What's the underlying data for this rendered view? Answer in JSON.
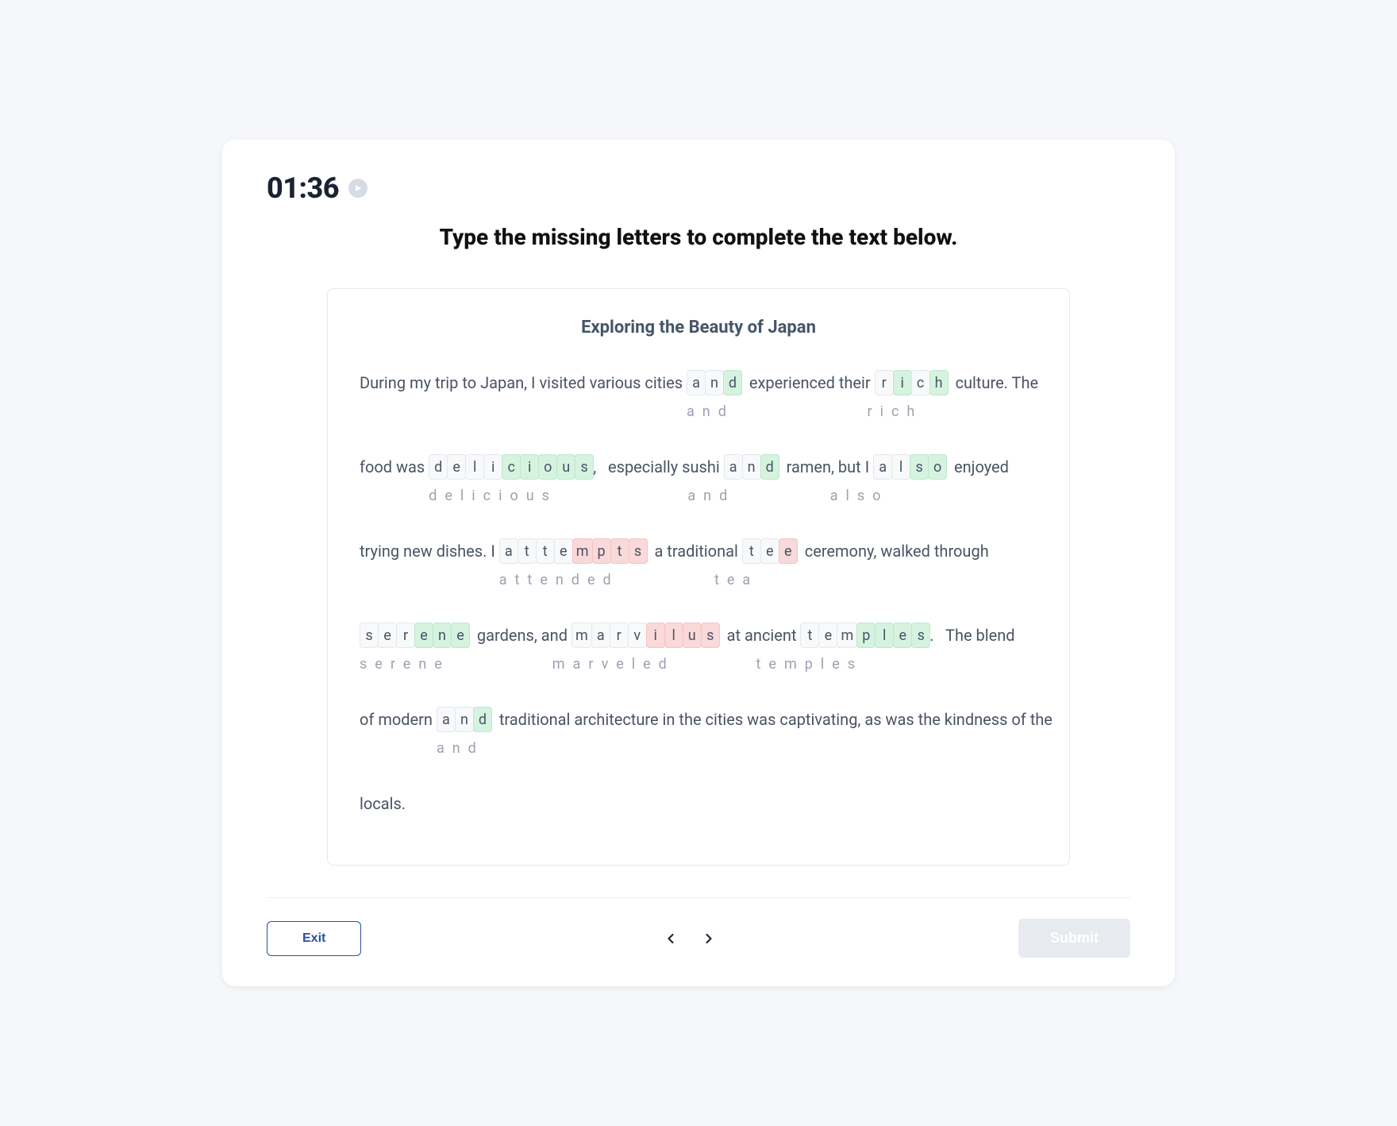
{
  "timer": "01:36",
  "prompt": "Type the missing letters to complete the text below.",
  "panel_title": "Exploring the Beauty of Japan",
  "footer": {
    "exit": "Exit",
    "submit": "Submit"
  },
  "lines": [
    {
      "segments": [
        {
          "type": "text",
          "value": "During my trip to Japan, I visited various cities "
        },
        {
          "type": "blank",
          "entered": [
            "a",
            "n",
            "d"
          ],
          "states": [
            "",
            "",
            "green"
          ],
          "answer": "and"
        },
        {
          "type": "text",
          "value": "  experienced their "
        },
        {
          "type": "blank",
          "entered": [
            "r",
            "i",
            "c",
            "h"
          ],
          "states": [
            "",
            "green",
            "",
            "green"
          ],
          "answer": "rich"
        },
        {
          "type": "text",
          "value": "  culture. The"
        }
      ]
    },
    {
      "segments": [
        {
          "type": "text",
          "value": "food was "
        },
        {
          "type": "blank",
          "entered": [
            "d",
            "e",
            "l",
            "i",
            "c",
            "i",
            "o",
            "u",
            "s"
          ],
          "states": [
            "",
            "",
            "",
            "",
            "green",
            "green",
            "green",
            "green",
            "green"
          ],
          "answer": "delicious"
        },
        {
          "type": "text",
          "value": ",   especially sushi "
        },
        {
          "type": "blank",
          "entered": [
            "a",
            "n",
            "d"
          ],
          "states": [
            "",
            "",
            "green"
          ],
          "answer": "and"
        },
        {
          "type": "text",
          "value": "  ramen, but I "
        },
        {
          "type": "blank",
          "entered": [
            "a",
            "l",
            "s",
            "o"
          ],
          "states": [
            "",
            "",
            "green",
            "green"
          ],
          "answer": "also"
        },
        {
          "type": "text",
          "value": "  enjoyed"
        }
      ]
    },
    {
      "segments": [
        {
          "type": "text",
          "value": "trying new dishes. I "
        },
        {
          "type": "blank",
          "entered": [
            "a",
            "t",
            "t",
            "e",
            "m",
            "p",
            "t",
            "s"
          ],
          "states": [
            "",
            "",
            "",
            "",
            "red",
            "red",
            "red",
            "red"
          ],
          "answer": "attended"
        },
        {
          "type": "text",
          "value": "  a traditional "
        },
        {
          "type": "blank",
          "entered": [
            "t",
            "e",
            "e"
          ],
          "states": [
            "",
            "",
            "red"
          ],
          "answer": "tea"
        },
        {
          "type": "text",
          "value": "  ceremony, walked through"
        }
      ]
    },
    {
      "segments": [
        {
          "type": "blank",
          "entered": [
            "s",
            "e",
            "r",
            "e",
            "n",
            "e"
          ],
          "states": [
            "",
            "",
            "",
            "green",
            "green",
            "green"
          ],
          "answer": "serene"
        },
        {
          "type": "text",
          "value": "  gardens, and "
        },
        {
          "type": "blank",
          "entered": [
            "m",
            "a",
            "r",
            "v",
            "i",
            "l",
            "u",
            "s"
          ],
          "states": [
            "",
            "",
            "",
            "",
            "red",
            "red",
            "red",
            "red"
          ],
          "answer": "marveled"
        },
        {
          "type": "text",
          "value": "  at ancient "
        },
        {
          "type": "blank",
          "entered": [
            "t",
            "e",
            "m",
            "p",
            "l",
            "e",
            "s"
          ],
          "states": [
            "",
            "",
            "",
            "green",
            "green",
            "green",
            "green"
          ],
          "answer": "temples"
        },
        {
          "type": "text",
          "value": ".   The blend"
        }
      ]
    },
    {
      "segments": [
        {
          "type": "text",
          "value": "of modern "
        },
        {
          "type": "blank",
          "entered": [
            "a",
            "n",
            "d"
          ],
          "states": [
            "",
            "",
            "green"
          ],
          "answer": "and"
        },
        {
          "type": "text",
          "value": "  traditional architecture in the cities was captivating, as was the kindness of the"
        }
      ]
    },
    {
      "segments": [
        {
          "type": "text",
          "value": "locals."
        }
      ]
    }
  ]
}
